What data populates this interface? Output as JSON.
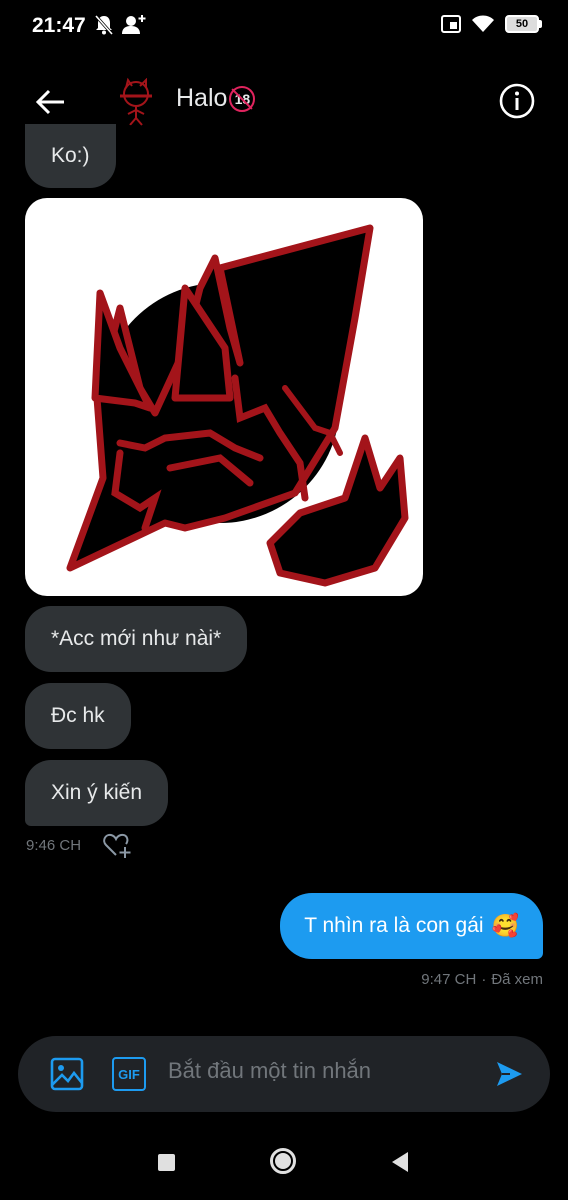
{
  "status_bar": {
    "time": "21:47",
    "battery": "50"
  },
  "header": {
    "contact_name": "Halo",
    "badge": "18"
  },
  "messages": [
    {
      "text": "Ko:)"
    },
    {
      "text": "*Acc mới như nài*"
    },
    {
      "text": "Đc hk"
    },
    {
      "text": "Xin ý kiến"
    }
  ],
  "received_meta": {
    "time": "9:46 CH"
  },
  "sent_message": {
    "text": "T nhìn ra là con gái",
    "emoji": "🥰"
  },
  "sent_meta": {
    "time": "9:47 CH",
    "status": "Đã xem"
  },
  "composer": {
    "placeholder": "Bắt đầu một tin nhắn",
    "gif_label": "GIF"
  },
  "colors": {
    "accent": "#1d9bf0",
    "incoming_bubble": "#2f3336",
    "background": "#000000",
    "drawing_red": "#a3141a"
  }
}
